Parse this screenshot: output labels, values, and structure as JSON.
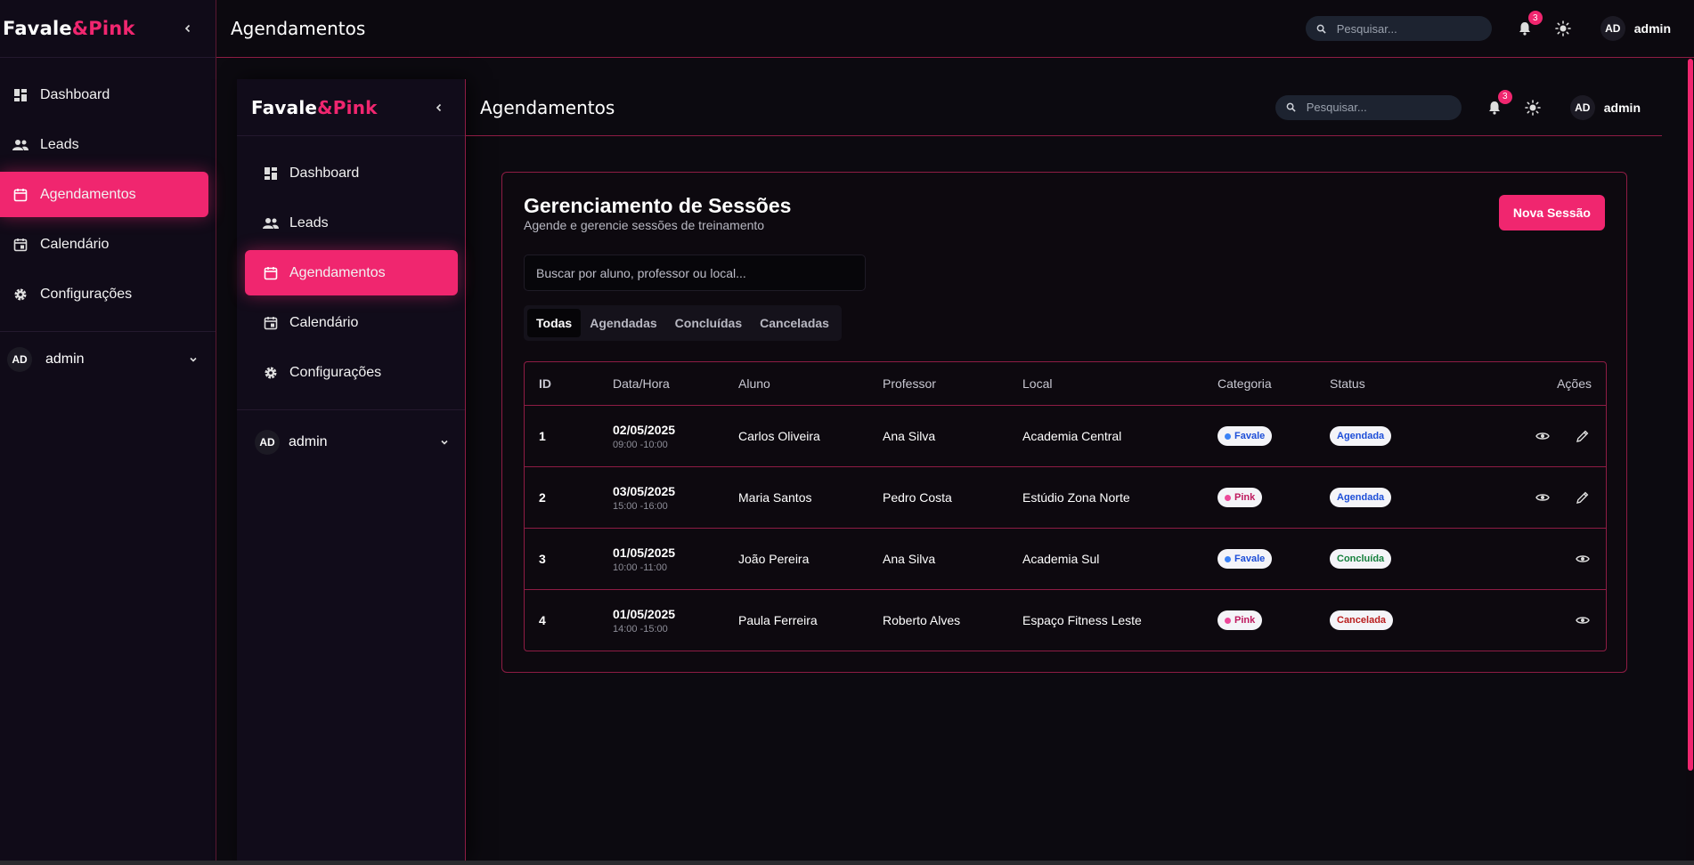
{
  "brand": {
    "name": "Favale",
    "amp": "&Pink"
  },
  "nav": [
    {
      "label": "Dashboard",
      "icon": "dashboard-icon"
    },
    {
      "label": "Leads",
      "icon": "users-icon"
    },
    {
      "label": "Agendamentos",
      "icon": "calendar-icon",
      "active": true
    },
    {
      "label": "Calendário",
      "icon": "calendar-day-icon"
    },
    {
      "label": "Configurações",
      "icon": "gear-icon"
    }
  ],
  "user": {
    "initials": "AD",
    "name": "admin"
  },
  "header": {
    "title": "Agendamentos",
    "search_placeholder": "Pesquisar...",
    "notifications": "3"
  },
  "page": {
    "title": "Gerenciamento de Sessões",
    "subtitle": "Agende e gerencie sessões de treinamento",
    "new_button": "Nova Sessão",
    "filter_placeholder": "Buscar por aluno, professor ou local...",
    "tabs": [
      "Todas",
      "Agendadas",
      "Concluídas",
      "Canceladas"
    ],
    "active_tab": "Todas"
  },
  "table": {
    "columns": [
      "ID",
      "Data/Hora",
      "Aluno",
      "Professor",
      "Local",
      "Categoria",
      "Status",
      "Ações"
    ],
    "rows": [
      {
        "id": "1",
        "date": "02/05/2025",
        "time": "09:00 -10:00",
        "aluno": "Carlos Oliveira",
        "professor": "Ana Silva",
        "local": "Academia Central",
        "categoria": "Favale",
        "status": "Agendada"
      },
      {
        "id": "2",
        "date": "03/05/2025",
        "time": "15:00 -16:00",
        "aluno": "Maria Santos",
        "professor": "Pedro Costa",
        "local": "Estúdio Zona Norte",
        "categoria": "Pink",
        "status": "Agendada"
      },
      {
        "id": "3",
        "date": "01/05/2025",
        "time": "10:00 -11:00",
        "aluno": "João Pereira",
        "professor": "Ana Silva",
        "local": "Academia Sul",
        "categoria": "Favale",
        "status": "Concluída"
      },
      {
        "id": "4",
        "date": "01/05/2025",
        "time": "14:00 -15:00",
        "aluno": "Paula Ferreira",
        "professor": "Roberto Alves",
        "local": "Espaço Fitness Leste",
        "categoria": "Pink",
        "status": "Cancelada"
      }
    ]
  },
  "colors": {
    "accent": "#f0266f",
    "favale_dot": "#3b82f6",
    "pink_dot": "#ec4899",
    "agendada": "#1d4ed8",
    "concluida": "#15803d",
    "cancelada": "#b91c1c"
  }
}
